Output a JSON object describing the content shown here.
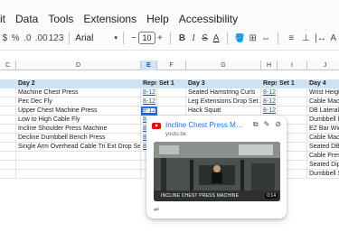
{
  "menu": {
    "items": [
      "it",
      "Data",
      "Tools",
      "Extensions",
      "Help",
      "Accessibility"
    ]
  },
  "toolbar": {
    "currency": "$",
    "percent": "%",
    "dec_decrease": ".0",
    "dec_increase": ".00",
    "number_format": "123",
    "font": "Arial",
    "font_size": "10",
    "minus": "−",
    "plus": "+",
    "bold": "B",
    "italic": "I",
    "strike": "S",
    "text_color": "A",
    "fill_color": "🪣",
    "borders": "⊞",
    "merge": "⇔",
    "align": "≡",
    "valign": "⊥",
    "wrap": "|↔",
    "rotate": "A"
  },
  "columns": [
    "C",
    "D",
    "E",
    "F",
    "G",
    "H",
    "I",
    "J"
  ],
  "selected_column": "E",
  "rows": [
    {
      "type": "header",
      "cells": [
        "",
        "Day 2",
        "Reps",
        "Set 1",
        "Day 3",
        "Reps",
        "Set 1",
        "Day 4"
      ]
    },
    {
      "cells": [
        "",
        "Machine Chest Press",
        "8-12",
        "",
        "Seated Hamstring Curls",
        "8-12",
        "",
        "Wrist Heigh"
      ]
    },
    {
      "cells": [
        "",
        "Pec Dec Fly",
        "8-12",
        "",
        "Leg Extensions Drop Set x2",
        "8-12",
        "",
        "Cable Machi"
      ]
    },
    {
      "cells": [
        "",
        "Upper Chest Machine Press",
        "8-12",
        "",
        "Hack Squat",
        "8-12",
        "",
        "DB Lateral R"
      ]
    },
    {
      "cells": [
        "",
        "Low to High Cable Fly",
        "8",
        "",
        "",
        "",
        "",
        "Dumbbell In"
      ]
    },
    {
      "cells": [
        "",
        "Incline Shoulder Press Machine",
        "8",
        "",
        "",
        "",
        "",
        "EZ Bar Wide"
      ]
    },
    {
      "cells": [
        "",
        "Decline Dumbbell Bench Press",
        "8",
        "",
        "",
        "",
        "",
        "Cable Machi"
      ]
    },
    {
      "cells": [
        "",
        "Single Arm Overhead Cable Tri Ext Drop Set x2",
        "8",
        "",
        "",
        "",
        "",
        "Seated DB I"
      ]
    },
    {
      "cells": [
        "",
        "",
        "",
        "",
        "",
        "",
        "",
        "Cable Press"
      ]
    },
    {
      "cells": [
        "",
        "",
        "",
        "",
        "",
        "",
        "",
        "Seated Dip"
      ]
    },
    {
      "cells": [
        "",
        "",
        "",
        "",
        "",
        "",
        "",
        "Dumbbell Si"
      ]
    }
  ],
  "link_cells": [
    [
      1,
      2
    ],
    [
      1,
      5
    ],
    [
      2,
      2
    ],
    [
      2,
      5
    ],
    [
      3,
      2
    ],
    [
      3,
      5
    ],
    [
      4,
      2
    ],
    [
      5,
      2
    ],
    [
      6,
      2
    ],
    [
      7,
      2
    ]
  ],
  "preview": {
    "title": "Incline Chest Press Machi...",
    "domain": "youtu.be",
    "video_title": "INCLINE CHEST PRESS MACHINE",
    "duration": "0:14",
    "footer_icon": "⇌"
  },
  "colors": {
    "header_fill": "#cfe2f3",
    "link": "#1155cc",
    "selection": "#1a73e8"
  }
}
